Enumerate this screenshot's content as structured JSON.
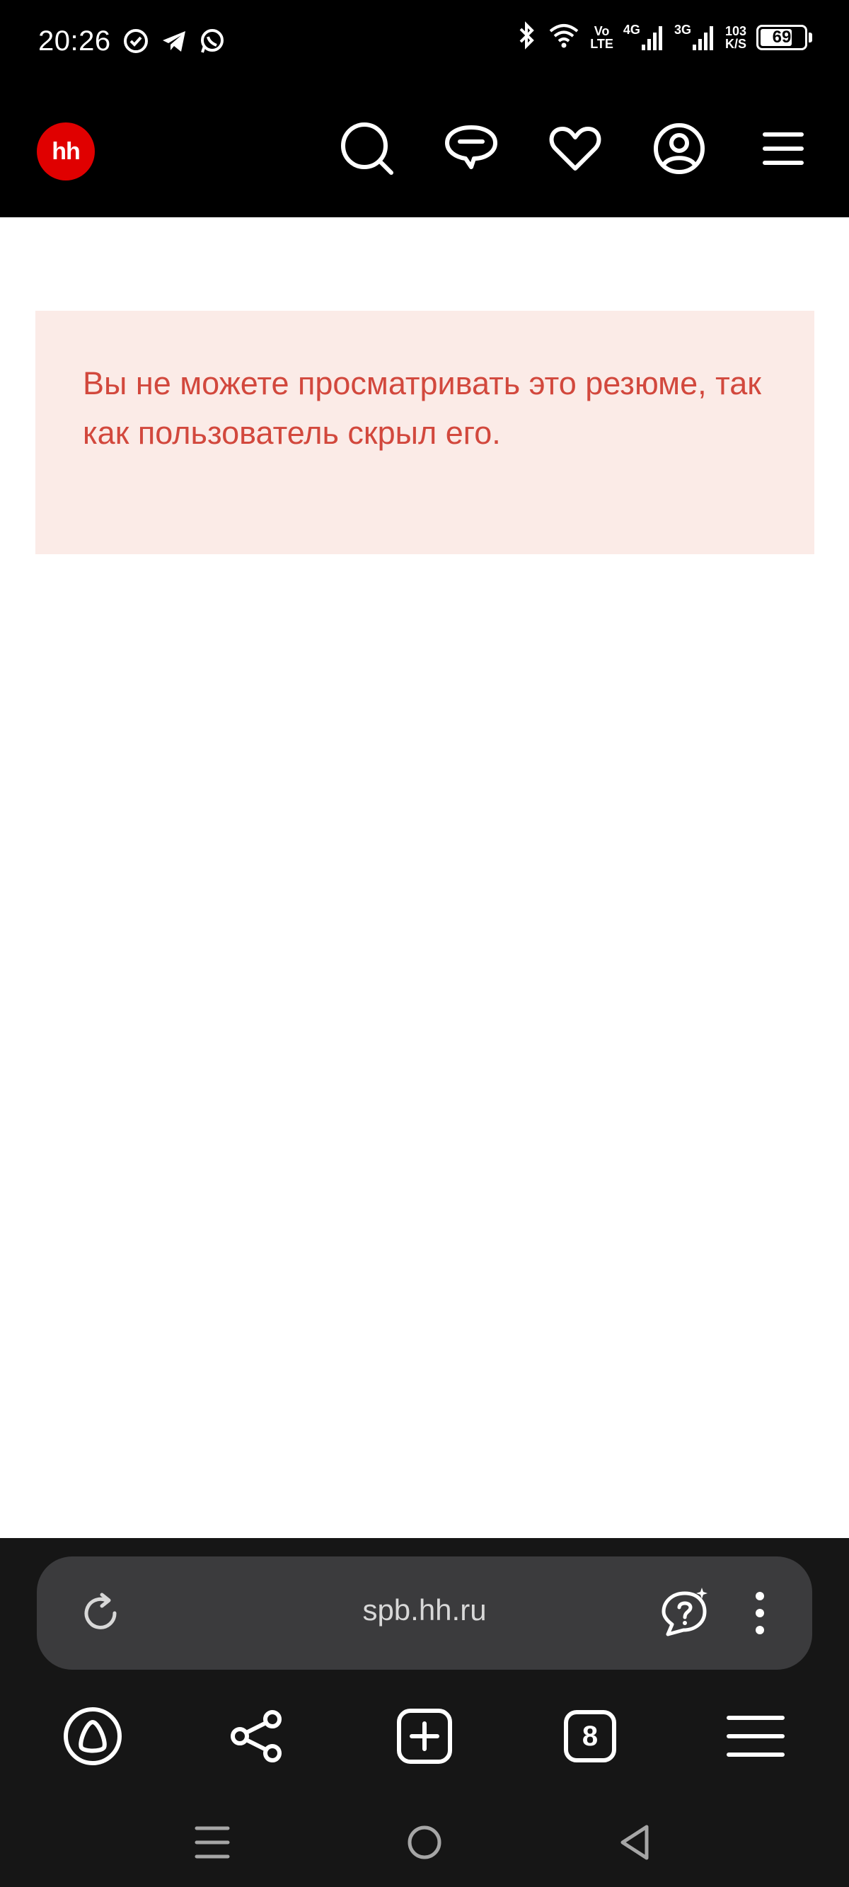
{
  "status_bar": {
    "time": "20:26",
    "left_icons": [
      "sync-check-icon",
      "telegram-icon",
      "whatsapp-icon"
    ],
    "right_icons": [
      "bluetooth-icon",
      "wifi-icon",
      "volte-icon",
      "4g-signal-icon",
      "3g-signal-icon",
      "speed-indicator",
      "battery-icon"
    ],
    "volte_top": "Vo",
    "volte_bottom": "LTE",
    "network_4g": "4G",
    "network_3g": "3G",
    "speed_value": "103",
    "speed_unit": "K/S",
    "battery_level": "69"
  },
  "header": {
    "logo_text": "hh",
    "logo_color": "#e00000",
    "icons": [
      "search-icon",
      "chat-icon",
      "favorites-heart-icon",
      "profile-icon",
      "menu-icon"
    ]
  },
  "main": {
    "message": "Вы не можете просматривать это резюме, так как пользователь скрыл его.",
    "message_color": "#d2483d",
    "message_bg": "#fbebe7"
  },
  "browser": {
    "url": "spb.hh.ru",
    "tabs_count": "8",
    "icons": [
      "reload-icon",
      "assistant-question-icon",
      "more-vertical-icon",
      "alice-icon",
      "share-icon",
      "new-tab-icon",
      "tabs-icon",
      "browser-menu-icon"
    ]
  },
  "system_nav": {
    "icons": [
      "recent-apps-icon",
      "home-icon",
      "back-icon"
    ]
  }
}
